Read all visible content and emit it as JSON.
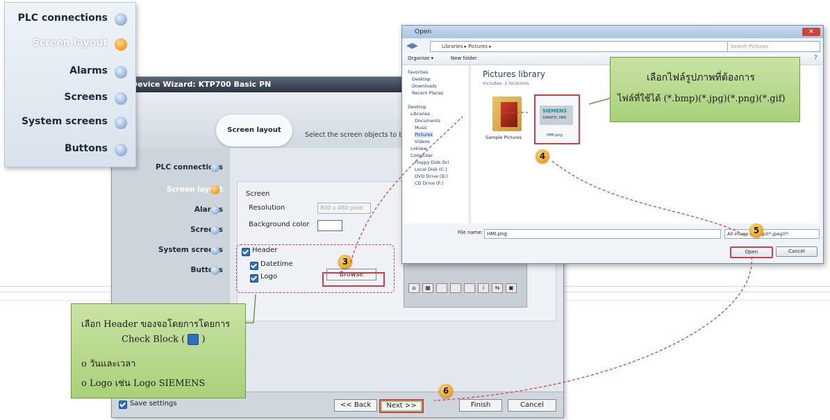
{
  "nav_panel": {
    "items": [
      {
        "label": "PLC connections",
        "state": "done"
      },
      {
        "label": "Screen layout",
        "state": "active"
      },
      {
        "label": "Alarms",
        "state": "pending"
      },
      {
        "label": "Screens",
        "state": "pending"
      },
      {
        "label": "System screens",
        "state": "pending"
      },
      {
        "label": "Buttons",
        "state": "pending"
      }
    ]
  },
  "wizard": {
    "title": "Device Wizard: KTP700 Basic PN",
    "bubble": "Screen layout",
    "instruction": "Select the screen objects to be",
    "nav": [
      "PLC connections",
      "Screen layout",
      "Alarms",
      "Screens",
      "System screens",
      "Buttons"
    ],
    "screen_group": "Screen",
    "resolution_label": "Resolution",
    "resolution_value": "800 x 480 pixel",
    "background_label": "Background color",
    "header_label": "Header",
    "datetime_label": "Datetime",
    "logo_label": "Logo",
    "browse_label": "Browse",
    "save_settings": "Save settings",
    "back_label": "<< Back",
    "next_label": "Next >>",
    "finish_label": "Finish",
    "cancel_label": "Cancel"
  },
  "open_dialog": {
    "title": "Open",
    "address": "Libraries ▸ Pictures ▸",
    "search_placeholder": "Search Pictures",
    "organize": "Organize ▾",
    "new_folder": "New folder",
    "sidebar": [
      "Favorites",
      "Desktop",
      "Downloads",
      "Recent Places",
      "Desktop",
      "Libraries",
      "Documents",
      "Music",
      "Pictures",
      "Videos",
      "Lokiww",
      "Computer",
      "Floppy Disk Dri",
      "Local Disk (C:)",
      "DVD Drive (D:)",
      "CD Drive (F:)"
    ],
    "library_title": "Pictures library",
    "library_sub": "Includes: 2 locations",
    "items": [
      "Sample Pictures",
      "HMI.png"
    ],
    "thumb_brand": "SIEMENS",
    "thumb_sub": "SIMATIC HMI",
    "filename_label": "File name:",
    "filename_value": "HMI.png",
    "filter_value": "All image (*.bmp)(*.jpeg)(*.",
    "open_label": "Open",
    "cancel_label": "Cancel"
  },
  "callouts": {
    "right_line1": "เลือกไฟล์รูปภาพที่ต้องการ",
    "right_line2": "ไฟล์ที่ใช้ได้ (*.bmp)(*.jpg)(*.png)(*.gif)",
    "left_line1": "เลือก Header ของจอโดยการโดยการ",
    "left_line2": "Check Block (",
    "left_line2_end": ")",
    "left_line3": "o วันและเวลา",
    "left_line4": "o Logo เช่น Logo SIEMENS"
  },
  "steps": [
    "3",
    "4",
    "5",
    "6"
  ]
}
